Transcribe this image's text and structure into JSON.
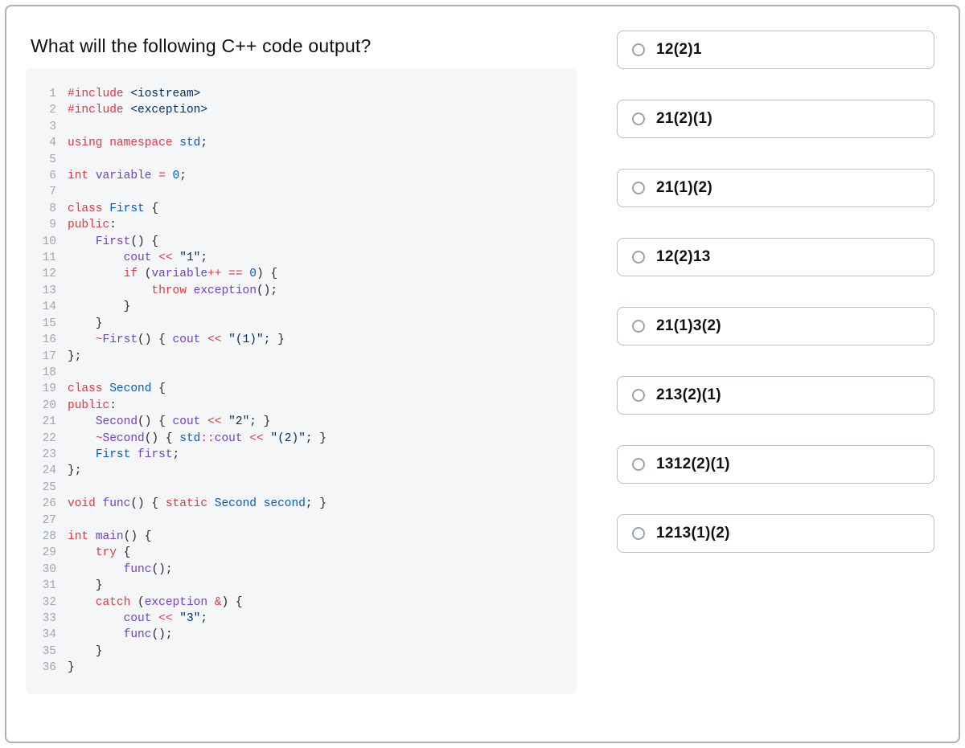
{
  "question": "What will the following C++ code output?",
  "options": [
    "12(2)1",
    "21(2)(1)",
    "21(1)(2)",
    "12(2)13",
    "21(1)3(2)",
    "213(2)(1)",
    "1312(2)(1)",
    "1213(1)(2)"
  ],
  "code": {
    "line_count": 36,
    "lines": [
      {
        "n": 1,
        "raw": "#include <iostream>"
      },
      {
        "n": 2,
        "raw": "#include <exception>"
      },
      {
        "n": 3,
        "raw": ""
      },
      {
        "n": 4,
        "raw": "using namespace std;"
      },
      {
        "n": 5,
        "raw": ""
      },
      {
        "n": 6,
        "raw": "int variable = 0;"
      },
      {
        "n": 7,
        "raw": ""
      },
      {
        "n": 8,
        "raw": "class First {"
      },
      {
        "n": 9,
        "raw": "public:"
      },
      {
        "n": 10,
        "raw": "    First() {"
      },
      {
        "n": 11,
        "raw": "        cout << \"1\";"
      },
      {
        "n": 12,
        "raw": "        if (variable++ == 0) {"
      },
      {
        "n": 13,
        "raw": "            throw exception();"
      },
      {
        "n": 14,
        "raw": "        }"
      },
      {
        "n": 15,
        "raw": "    }"
      },
      {
        "n": 16,
        "raw": "    ~First() { cout << \"(1)\"; }"
      },
      {
        "n": 17,
        "raw": "};"
      },
      {
        "n": 18,
        "raw": ""
      },
      {
        "n": 19,
        "raw": "class Second {"
      },
      {
        "n": 20,
        "raw": "public:"
      },
      {
        "n": 21,
        "raw": "    Second() { cout << \"2\"; }"
      },
      {
        "n": 22,
        "raw": "    ~Second() { std::cout << \"(2)\"; }"
      },
      {
        "n": 23,
        "raw": "    First first;"
      },
      {
        "n": 24,
        "raw": "};"
      },
      {
        "n": 25,
        "raw": ""
      },
      {
        "n": 26,
        "raw": "void func() { static Second second; }"
      },
      {
        "n": 27,
        "raw": ""
      },
      {
        "n": 28,
        "raw": "int main() {"
      },
      {
        "n": 29,
        "raw": "    try {"
      },
      {
        "n": 30,
        "raw": "        func();"
      },
      {
        "n": 31,
        "raw": "    }"
      },
      {
        "n": 32,
        "raw": "    catch (exception &) {"
      },
      {
        "n": 33,
        "raw": "        cout << \"3\";"
      },
      {
        "n": 34,
        "raw": "        func();"
      },
      {
        "n": 35,
        "raw": "    }"
      },
      {
        "n": 36,
        "raw": "}"
      }
    ]
  }
}
